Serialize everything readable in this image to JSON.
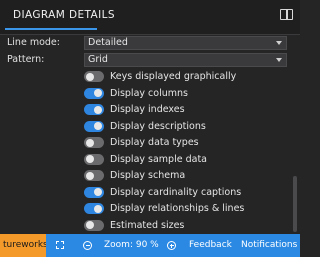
{
  "header": {
    "title": "DIAGRAM DETAILS",
    "panel_icon": "panel-toggle-icon"
  },
  "settings": {
    "line_mode": {
      "label": "Line mode:",
      "value": "Detailed"
    },
    "pattern": {
      "label": "Pattern:",
      "value": "Grid"
    }
  },
  "toggles": [
    {
      "label": "Keys displayed graphically",
      "on": false
    },
    {
      "label": "Display columns",
      "on": true
    },
    {
      "label": "Display indexes",
      "on": true
    },
    {
      "label": "Display descriptions",
      "on": true
    },
    {
      "label": "Display data types",
      "on": false
    },
    {
      "label": "Display sample data",
      "on": false
    },
    {
      "label": "Display schema",
      "on": false
    },
    {
      "label": "Display cardinality captions",
      "on": true
    },
    {
      "label": "Display relationships & lines",
      "on": true
    },
    {
      "label": "Estimated sizes",
      "on": false
    }
  ],
  "footer": {
    "brand": "tureworks-",
    "zoom_label": "Zoom: 90 %",
    "feedback": "Feedback",
    "notifications": "Notifications",
    "colors": {
      "bar": "#2b89e3",
      "brand_bg": "#f49a2b"
    }
  },
  "colors": {
    "accent": "#3b95e8",
    "toggle_on": "#2f86e0",
    "toggle_off": "#6b6b6e"
  }
}
